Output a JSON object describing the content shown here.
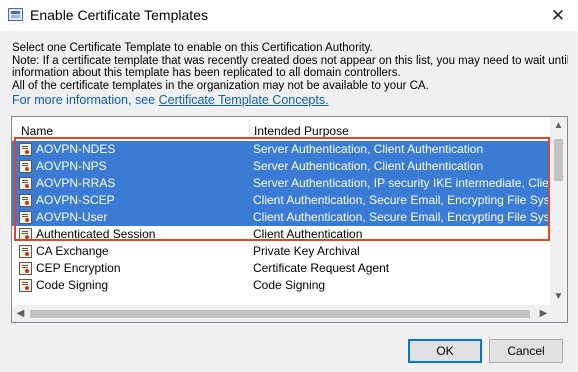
{
  "window": {
    "title": "Enable Certificate Templates",
    "close_glyph": "✕"
  },
  "description": {
    "lines": [
      "Select one Certificate Template to enable on this Certification Authority.",
      "Note: If a certificate template that was recently created does not appear on this list, you may need to wait until",
      "information about this template has been replicated to all domain controllers.",
      "All of the certificate templates in the organization may not be available to your CA."
    ],
    "more_prefix": "For more information, see ",
    "more_link": "Certificate Template Concepts.",
    "link_color": "#0a5fb0"
  },
  "list": {
    "headers": {
      "name": "Name",
      "purpose": "Intended Purpose"
    },
    "selection_color": "#3a7bd5",
    "highlight_color": "#e0452a",
    "rows": [
      {
        "name": "AOVPN-NDES",
        "purpose": "Server Authentication, Client Authentication",
        "selected": true
      },
      {
        "name": "AOVPN-NPS",
        "purpose": "Server Authentication, Client Authentication",
        "selected": true
      },
      {
        "name": "AOVPN-RRAS",
        "purpose": "Server Authentication, IP security IKE intermediate, Client Auth",
        "selected": true
      },
      {
        "name": "AOVPN-SCEP",
        "purpose": "Client Authentication, Secure Email, Encrypting File System",
        "selected": true
      },
      {
        "name": "AOVPN-User",
        "purpose": "Client Authentication, Secure Email, Encrypting File System",
        "selected": true
      },
      {
        "name": "Authenticated Session",
        "purpose": "Client Authentication",
        "selected": false
      },
      {
        "name": "CA Exchange",
        "purpose": "Private Key Archival",
        "selected": false
      },
      {
        "name": "CEP Encryption",
        "purpose": "Certificate Request Agent",
        "selected": false
      },
      {
        "name": "Code Signing",
        "purpose": "Code Signing",
        "selected": false
      }
    ],
    "icon": "certificate-icon"
  },
  "buttons": {
    "ok": "OK",
    "cancel": "Cancel"
  }
}
